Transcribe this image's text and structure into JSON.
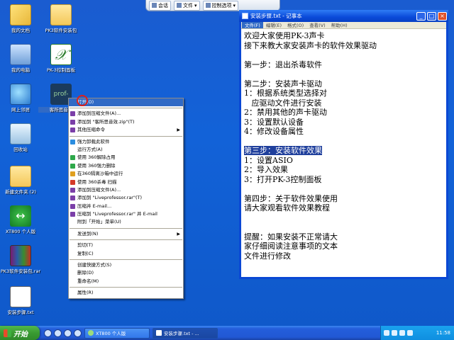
{
  "desktop": {
    "icons": [
      {
        "label": "我的文档",
        "icon": "my-documents-icon"
      },
      {
        "label": "PK3软件安装包",
        "icon": "folder-icon"
      },
      {
        "label": "我的电脑",
        "icon": "my-computer-icon"
      },
      {
        "label": "PK-3控制面板",
        "icon": "pk3-control-panel-icon"
      },
      {
        "label": "网上邻居",
        "icon": "network-icon"
      },
      {
        "label": "客所思音效",
        "icon": "professor-effects-icon",
        "glyph": "prof-"
      },
      {
        "label": "回收站",
        "icon": "recycle-bin-icon"
      },
      {
        "label": "新建文件夹 (2)",
        "icon": "folder-icon"
      },
      {
        "label": "XT800 个人版",
        "icon": "xt800-icon"
      },
      {
        "label": "PK3软件安装包.rar",
        "icon": "rar-archive-icon"
      },
      {
        "label": "安装步骤.txt",
        "icon": "text-file-icon"
      }
    ]
  },
  "qqbar": {
    "chat": "会话",
    "file": "文件",
    "control": "控制选项"
  },
  "notepad": {
    "title": "安装步骤.txt - 记事本",
    "menu": [
      "文件(F)",
      "编辑(E)",
      "格式(O)",
      "查看(V)",
      "帮助(H)"
    ],
    "lines": [
      "欢迎大家使用PK-3声卡",
      "接下来教大家安装声卡的软件效果驱动",
      "",
      "第一步：退出杀毒软件",
      "",
      "第二步：安装声卡驱动",
      "1：根据系统类型选择对",
      "   应驱动文件进行安装",
      "2：禁用其他的声卡驱动",
      "3：设置默认设备",
      "4：修改设备属性",
      "",
      "第三步：安装软件效果",
      "1：设置ASIO",
      "2：导入效果",
      "3：打开PK-3控制面板",
      "",
      "第四步：关于软件效果使用",
      "请大家观看软件效果教程",
      "",
      "",
      "提醒：如果安装不正常请大",
      "家仔细阅读注意事项的文本",
      "文件进行修改"
    ],
    "selected_line_index": 12
  },
  "context_menu": {
    "items": [
      {
        "type": "item",
        "label": "打开(O)",
        "highlight": true
      },
      {
        "type": "sep"
      },
      {
        "type": "item",
        "label": "添加到压缩文件(A)...",
        "icon_color": "#7b3fa8"
      },
      {
        "type": "item",
        "label": "添加到 \"客所思音效.zip\"(T)",
        "icon_color": "#7b3fa8"
      },
      {
        "type": "item",
        "label": "其他压缩命令",
        "icon_color": "#7b3fa8",
        "submenu": true
      },
      {
        "type": "sep"
      },
      {
        "type": "item",
        "label": "强力卸载此软件",
        "icon_color": "#2a8de0"
      },
      {
        "type": "item",
        "label": "运行方式(A)",
        "icon_color": ""
      },
      {
        "type": "item",
        "label": "使用 360解除占用",
        "icon_color": "#2ea84a"
      },
      {
        "type": "item",
        "label": "使用 360强力删除",
        "icon_color": "#2ea84a"
      },
      {
        "type": "item",
        "label": "在360隔离沙箱中运行",
        "icon_color": "#e0a020"
      },
      {
        "type": "item",
        "label": "使用 360杀毒 扫描",
        "icon_color": "#d43a2a"
      },
      {
        "type": "item",
        "label": "添加到压缩文件(A)...",
        "icon_color": "#7b3fa8"
      },
      {
        "type": "item",
        "label": "添加到 \"Liveprofessor.rar\"(T)",
        "icon_color": "#7b3fa8"
      },
      {
        "type": "item",
        "label": "压缩并 E-mail...",
        "icon_color": "#7b3fa8"
      },
      {
        "type": "item",
        "label": "压缩到 \"Liveprofessor.rar\" 并 E-mail",
        "icon_color": "#7b3fa8"
      },
      {
        "type": "item",
        "label": "附到「开始」菜单(U)",
        "icon_color": ""
      },
      {
        "type": "sep"
      },
      {
        "type": "item",
        "label": "发送到(N)",
        "icon_color": "",
        "submenu": true
      },
      {
        "type": "sep"
      },
      {
        "type": "item",
        "label": "剪切(T)",
        "icon_color": ""
      },
      {
        "type": "item",
        "label": "复制(C)",
        "icon_color": ""
      },
      {
        "type": "sep"
      },
      {
        "type": "item",
        "label": "创建快捷方式(S)",
        "icon_color": ""
      },
      {
        "type": "item",
        "label": "删除(D)",
        "icon_color": ""
      },
      {
        "type": "item",
        "label": "重命名(M)",
        "icon_color": ""
      },
      {
        "type": "sep"
      },
      {
        "type": "item",
        "label": "属性(R)",
        "icon_color": ""
      }
    ]
  },
  "taskbar": {
    "start": "开始",
    "tasks": [
      {
        "label": "XT800 个人版"
      },
      {
        "label": "安装步骤.txt - ..."
      }
    ],
    "clock": "11:58"
  }
}
